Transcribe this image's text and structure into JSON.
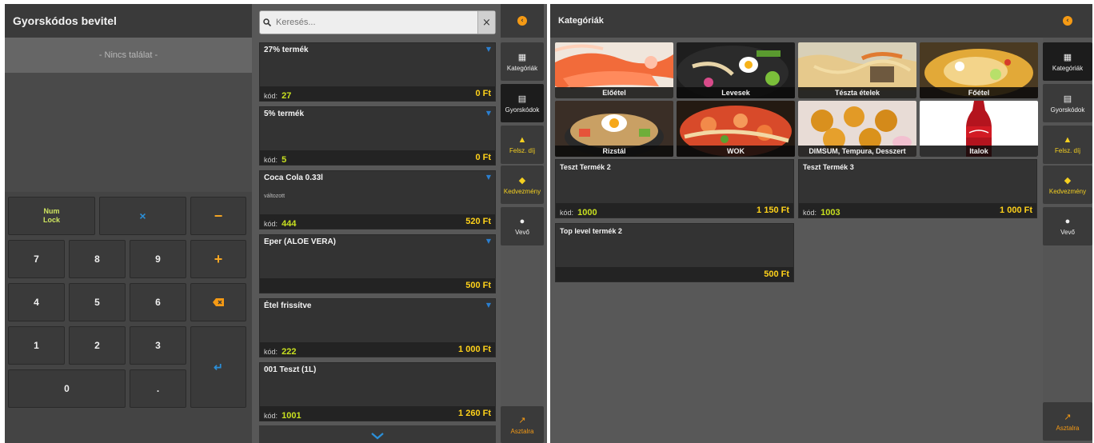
{
  "left": {
    "header_title": "Gyorskódos bevitel",
    "no_result": "- Nincs találat -",
    "keypad": {
      "numlock_line1": "Num",
      "numlock_line2": "Lock",
      "multiply": "×",
      "minus": "−",
      "plus": "+",
      "k7": "7",
      "k8": "8",
      "k9": "9",
      "k4": "4",
      "k5": "5",
      "k6": "6",
      "k1": "1",
      "k2": "2",
      "k3": "3",
      "k0": "0",
      "dot": ".",
      "enter": "↵"
    },
    "search": {
      "placeholder": "Keresés...",
      "clear": "×"
    },
    "kod_label": "kód:",
    "products": [
      {
        "name": "27% termék",
        "code": "27",
        "price": "0 Ft",
        "note": ""
      },
      {
        "name": "5% termék",
        "code": "5",
        "price": "0 Ft",
        "note": ""
      },
      {
        "name": "Coca Cola 0.33l",
        "code": "444",
        "price": "520 Ft",
        "note": "változott"
      },
      {
        "name": "Eper (ALOE VERA)",
        "code": "",
        "price": "500 Ft",
        "note": ""
      },
      {
        "name": "Étel frissítve",
        "code": "222",
        "price": "1 000 Ft",
        "note": ""
      },
      {
        "name": "001 Teszt (1L)",
        "code": "1001",
        "price": "1 260 Ft",
        "note": ""
      }
    ],
    "scroll_down": "⌄"
  },
  "sidebar": {
    "back": "‹",
    "items": [
      {
        "label": "Kategóriák",
        "icon": "grid-icon"
      },
      {
        "label": "Gyorskódok",
        "icon": "calculator-icon"
      },
      {
        "label": "Felsz. díj",
        "icon": "service-bell-icon"
      },
      {
        "label": "Kedvezmény",
        "icon": "tag-icon"
      },
      {
        "label": "Vevő",
        "icon": "user-icon"
      }
    ],
    "tables_label": "Asztalra"
  },
  "right": {
    "header_title": "Kategóriák",
    "categories": [
      {
        "label": "Előétel"
      },
      {
        "label": "Levesek"
      },
      {
        "label": "Tészta ételek"
      },
      {
        "label": "Főétel"
      },
      {
        "label": "Rizstál"
      },
      {
        "label": "WOK"
      },
      {
        "label": "DIMSUM, Tempura, Desszert"
      },
      {
        "label": "Italok"
      }
    ],
    "kod_label": "kód:",
    "products": [
      {
        "name": "Teszt Termék 2",
        "code": "1000",
        "price": "1 150 Ft"
      },
      {
        "name": "Teszt Termék 3",
        "code": "1003",
        "price": "1 000 Ft"
      },
      {
        "name": "Top level termék 2",
        "code": "",
        "price": "500 Ft"
      }
    ]
  },
  "colors": {
    "accent_orange": "#f59a14",
    "code_green": "#c8e020",
    "price_yellow": "#ffd21a",
    "pin_blue": "#2b7fd0"
  }
}
